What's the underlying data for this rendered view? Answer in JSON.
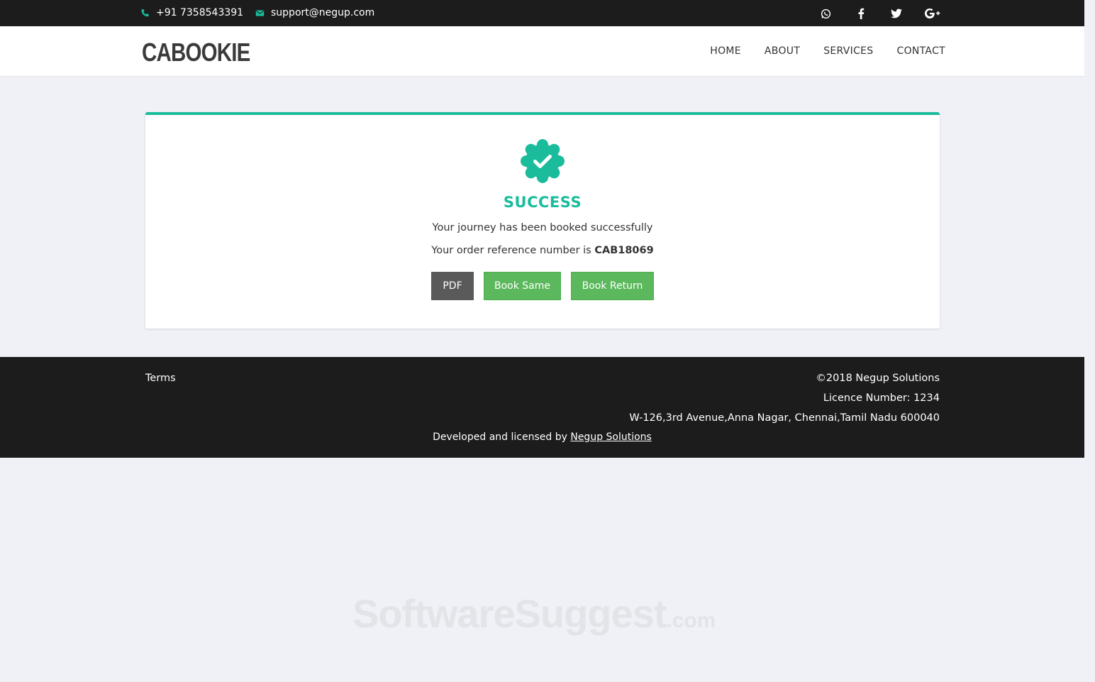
{
  "topbar": {
    "phone": "+91 7358543391",
    "email": "support@negup.com",
    "social": [
      "whatsapp-icon",
      "facebook-icon",
      "twitter-icon",
      "google-plus-icon"
    ]
  },
  "navbar": {
    "logo": "CABOOKIE",
    "links": [
      "HOME",
      "ABOUT",
      "SERVICES",
      "CONTACT"
    ]
  },
  "card": {
    "icon": "check-badge-icon",
    "title": "SUCCESS",
    "message": "Your journey has been booked successfully",
    "reference_prefix": "Your order reference number is",
    "reference_number": "CAB18069",
    "buttons": {
      "pdf": "PDF",
      "book_same": "Book Same",
      "book_return": "Book Return"
    }
  },
  "footer": {
    "terms": "Terms",
    "copyright": "©2018 Negup Solutions",
    "licence": "Licence Number: 1234",
    "address": "W-126,3rd Avenue,Anna Nagar, Chennai,Tamil Nadu 600040",
    "developed_by_prefix": "Developed and licensed by",
    "developed_by_link": "Negup Solutions"
  },
  "watermark": {
    "main": "SoftwareSuggest",
    "suffix": ".com"
  },
  "colors": {
    "accent": "#1abc9c",
    "dark": "#1c1c1c",
    "button_green": "#5cb85c",
    "button_gray": "#5a5a5a",
    "background": "#eff1f6"
  }
}
